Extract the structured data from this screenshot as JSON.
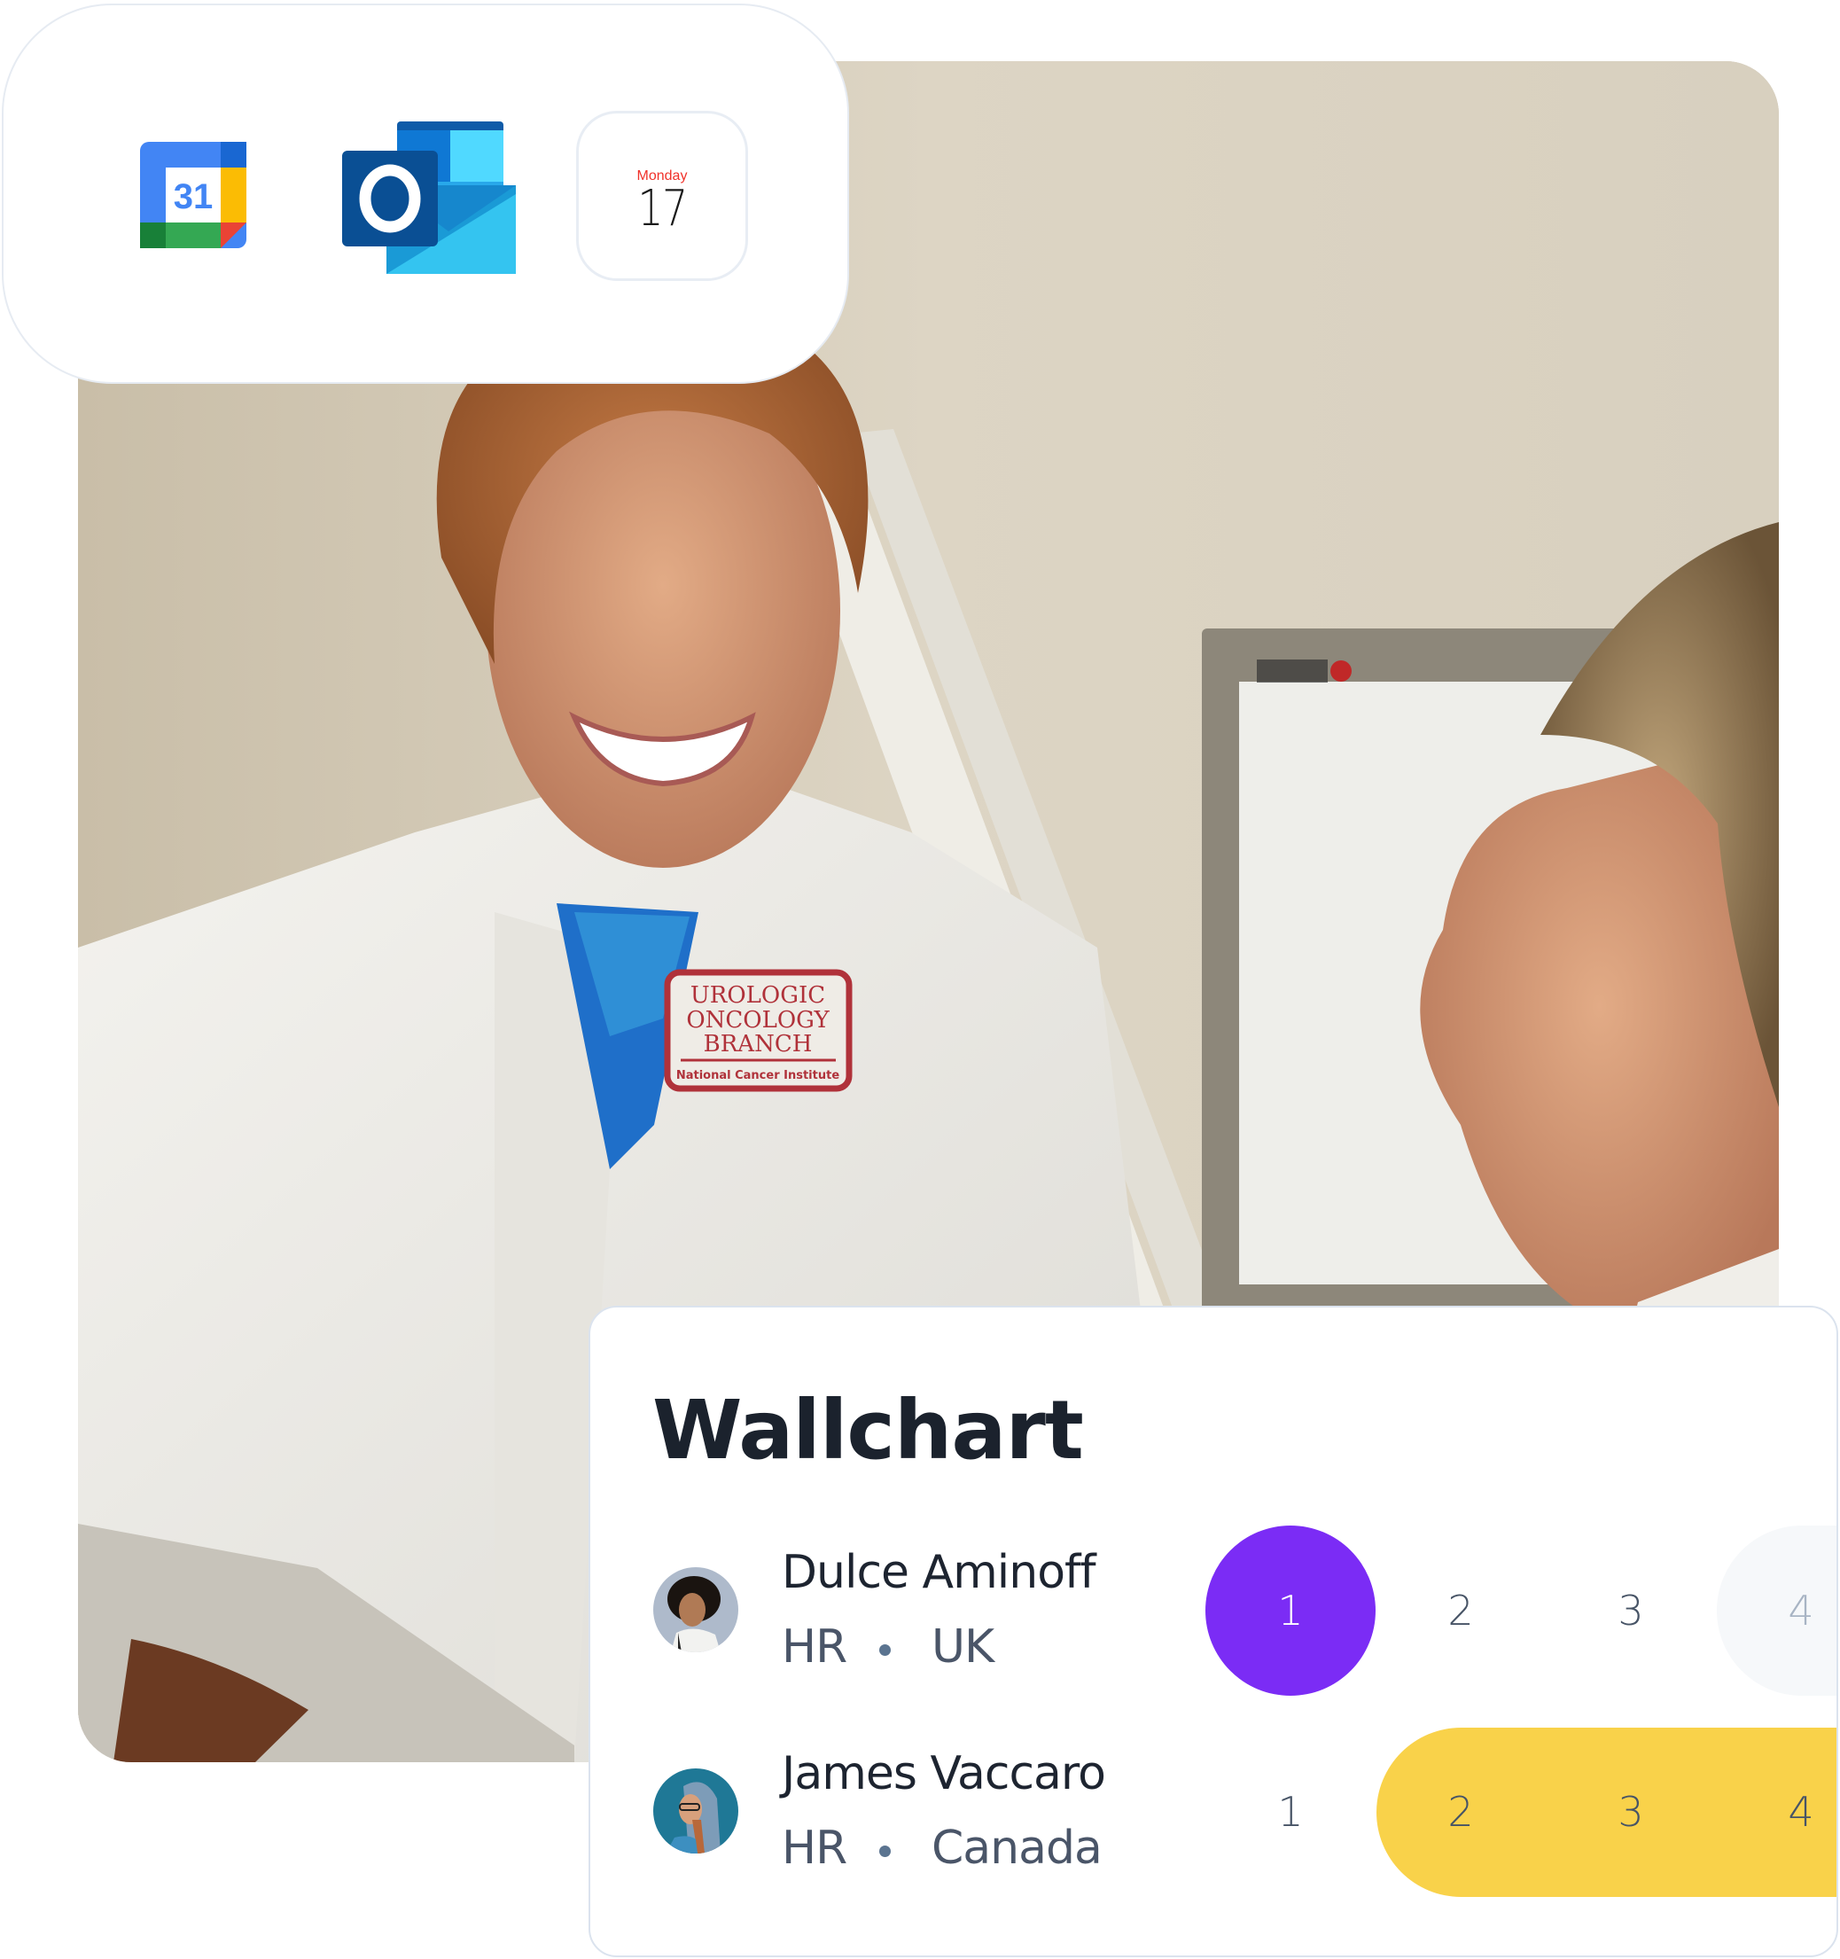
{
  "photo": {
    "description": "Smiling doctor in white lab coat talking with a patient in an exam room",
    "patch": {
      "lines": [
        "UROLOGIC",
        "ONCOLOGY",
        "BRANCH"
      ],
      "subtitle": "National Cancer Institute"
    }
  },
  "integrations": {
    "items": [
      {
        "name": "Google Calendar",
        "icon": "google-calendar-icon",
        "label": "31"
      },
      {
        "name": "Microsoft Outlook",
        "icon": "outlook-icon",
        "label": "O"
      },
      {
        "name": "Apple Calendar",
        "icon": "apple-calendar-icon",
        "day": "Monday",
        "date": "17"
      }
    ]
  },
  "wallchart": {
    "title": "Wallchart",
    "colors": {
      "selected": "#7b2cf5",
      "range": "#f9d24a",
      "weekend": "#f6f8fa"
    },
    "days": [
      "1",
      "2",
      "3",
      "4"
    ],
    "people": [
      {
        "name": "Dulce Aminoff",
        "department": "HR",
        "location": "UK",
        "selected_days": [
          1
        ],
        "muted_days": [
          4
        ]
      },
      {
        "name": "James Vaccaro",
        "department": "HR",
        "location": "Canada",
        "selected_days": [
          2,
          3,
          4
        ],
        "muted_days": []
      }
    ]
  }
}
